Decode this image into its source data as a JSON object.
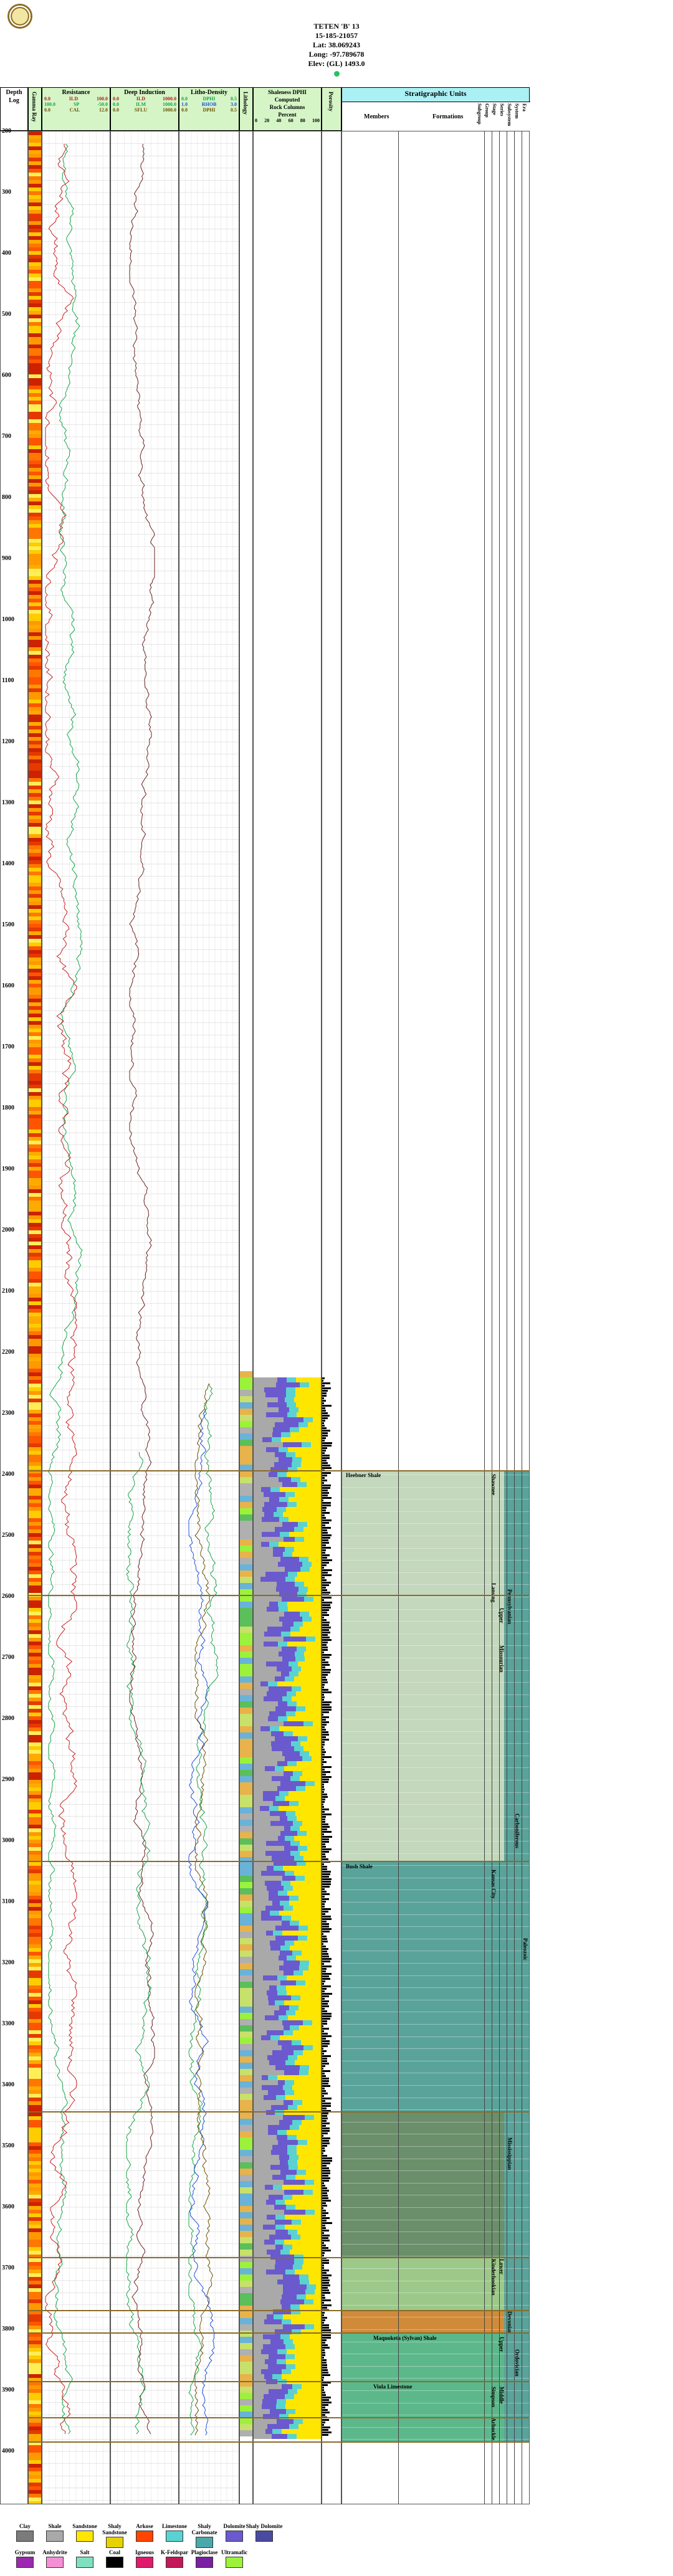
{
  "header": {
    "well_name": "TETEN 'B' 13",
    "api": "15-185-21057",
    "lat": "Lat: 38.069243",
    "long": "Long: -97.789678",
    "elev": "Elev: (GL) 1493.0"
  },
  "columns": {
    "depth": {
      "line1": "Depth",
      "line2": "Log"
    },
    "gamma": "Gamma Ray",
    "resistance": {
      "title": "Resistance",
      "rows": [
        [
          "0.0",
          "ILD",
          "100.0"
        ],
        [
          "100.0",
          "SP",
          "-50.0"
        ],
        [
          "0.0",
          "CAL",
          "12.0"
        ]
      ]
    },
    "induction": {
      "title": "Deep Induction",
      "rows": [
        [
          "0.0",
          "ILD",
          "1000.0"
        ],
        [
          "0.0",
          "ILM",
          "1000.0"
        ],
        [
          "0.0",
          "SFLU",
          "1000.0"
        ]
      ]
    },
    "litho": {
      "title": "Litho-Density",
      "rows": [
        [
          "0.0",
          "DPHI",
          "0.5"
        ],
        [
          "1.0",
          "RHOB",
          "3.0"
        ],
        [
          "0.0",
          "DPHI",
          "0.5"
        ]
      ]
    },
    "lithology": "Lithology",
    "shale_pct": {
      "title": "Shaleness DPHI",
      "line2": "Computed",
      "line3": "Rock Columns",
      "line4": "Percent",
      "ticks": [
        "0",
        "20",
        "40",
        "60",
        "80",
        "100"
      ]
    },
    "porosity": {
      "title": "Porosity",
      "ticks": [
        "0",
        "30"
      ]
    },
    "strat": {
      "title": "Stratigraphic Units",
      "members": "Members",
      "formations": "Formations",
      "cols": [
        "Subgroup",
        "Group",
        "Stage",
        "Series",
        "Subsystem",
        "System",
        "Era"
      ]
    }
  },
  "depths": [
    "200",
    "300",
    "400",
    "500",
    "600",
    "700",
    "800",
    "900",
    "1000",
    "1100",
    "1200",
    "1300",
    "1400",
    "1500",
    "1600",
    "1700",
    "1800",
    "1900",
    "2000",
    "2100",
    "2200",
    "2300",
    "2400",
    "2500",
    "2600",
    "2700",
    "2800",
    "2900",
    "3000",
    "3100",
    "3200",
    "3300",
    "3400",
    "3500",
    "3600",
    "3700",
    "3800",
    "3900",
    "4000"
  ],
  "strat_labels": {
    "heebner": "Heebner Shale",
    "bush": "Bush Shale",
    "maquoketa": "Maquoketa (Sylvan) Shale",
    "viola": "Viola Limestone",
    "shawnee": "Shawnee",
    "lansing": "Lansing",
    "upper": "Upper",
    "pennsylvanian": "Pennsylvanian",
    "missourian": "Missourian",
    "kansas_city": "Kansas City",
    "carboniferous": "Carboniferous",
    "paleozoic": "Paleozoic",
    "mississippian": "Mississippian",
    "lower": "Lower",
    "kinderhookian": "Kinderhookian",
    "devonian": "Devonian",
    "ordovician": "Ordovician",
    "middle": "Middle",
    "simpson": "Simpson",
    "arbuckle": "Arbuckle",
    "upper2": "Upper"
  },
  "legend": [
    {
      "label": "Clay",
      "color": "#7b7b7b"
    },
    {
      "label": "Shale",
      "color": "#a9a9a9"
    },
    {
      "label": "Sandstone",
      "color": "#ffe600"
    },
    {
      "label": "Shaly Sandstone",
      "color": "#e6d200"
    },
    {
      "label": "Arkose",
      "color": "#ff4500"
    },
    {
      "label": "Limestone",
      "color": "#5ad2d2"
    },
    {
      "label": "Shaly Carbonate",
      "color": "#4aa8a8"
    },
    {
      "label": "Dolomite",
      "color": "#6a5acd"
    },
    {
      "label": "Shaly Dolomite",
      "color": "#4a4aa0"
    },
    {
      "label": "Gypsum",
      "color": "#9c27b0"
    },
    {
      "label": "Anhydrite",
      "color": "#f48fd6"
    },
    {
      "label": "Salt",
      "color": "#7fe0c0"
    },
    {
      "label": "Coal",
      "color": "#000000"
    },
    {
      "label": "Igneous",
      "color": "#e01a6a"
    },
    {
      "label": "K-Feldspar",
      "color": "#c2185b"
    },
    {
      "label": "Plagioclase",
      "color": "#7b1fa2"
    },
    {
      "label": "Ultramafic",
      "color": "#9cf23a"
    }
  ],
  "colors": {
    "header_green": "#d5f5c6",
    "strat_green": "#c3d8bc",
    "strat_teal": "#5aa39a",
    "strat_dark": "#6a8f6a",
    "strat_orange": "#d08b3a"
  }
}
